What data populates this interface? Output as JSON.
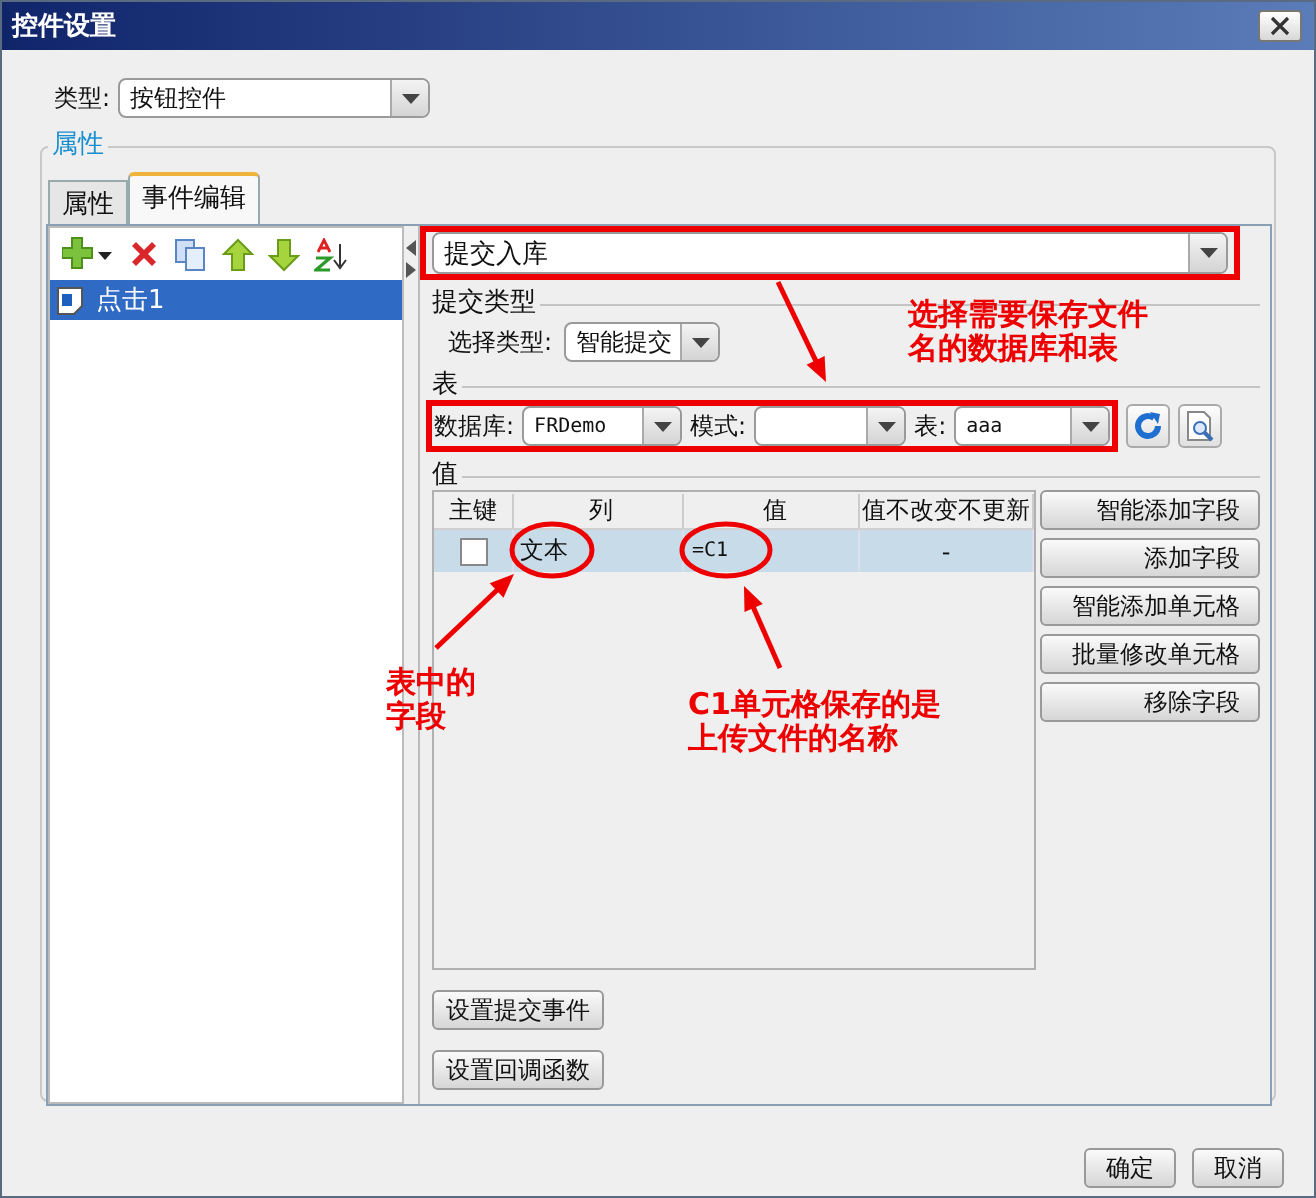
{
  "window": {
    "title": "控件设置"
  },
  "type_field": {
    "label": "类型:",
    "value": "按钮控件"
  },
  "group": {
    "title": "属性"
  },
  "tabs": [
    {
      "label": "属性",
      "selected": false
    },
    {
      "label": "事件编辑",
      "selected": true
    }
  ],
  "events": [
    {
      "label": "点击1",
      "selected": true
    }
  ],
  "action": {
    "value": "提交入库"
  },
  "submit_type": {
    "title": "提交类型",
    "label": "选择类型:",
    "value": "智能提交"
  },
  "table_section": {
    "title": "表",
    "database_label": "数据库:",
    "database": "FRDemo",
    "schema_label": "模式:",
    "table_label": "表:",
    "table": "aaa"
  },
  "values": {
    "title": "值",
    "columns": [
      "主键",
      "列",
      "值",
      "值不改变不更新"
    ],
    "rows": [
      {
        "checked": false,
        "column": "文本",
        "value": "=C1",
        "no_update": "-",
        "selected": true
      }
    ],
    "buttons": [
      "智能添加字段",
      "添加字段",
      "智能添加单元格",
      "批量修改单元格",
      "移除字段"
    ]
  },
  "bottom_buttons": [
    "设置提交事件",
    "设置回调函数"
  ],
  "dialog_buttons": [
    "确定",
    "取消"
  ],
  "annotations": [
    {
      "lines": [
        "选择需要保存文件",
        "名的数据库和表"
      ]
    },
    {
      "lines": [
        "表中的",
        "字段"
      ]
    },
    {
      "lines": [
        "C1单元格保存的是",
        "上传文件的名称"
      ]
    }
  ]
}
